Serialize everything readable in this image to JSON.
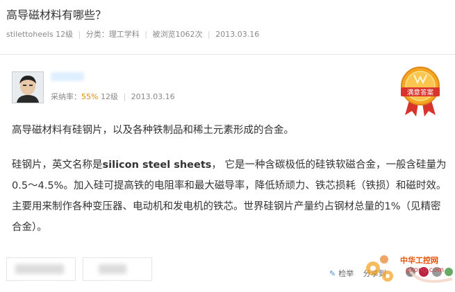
{
  "question": {
    "title": "高导磁材料有哪些？",
    "author": "stilettoheels",
    "author_level": "12级",
    "category": "分类：理工学科",
    "views": "被浏览1062次",
    "date": "2013.03.16"
  },
  "answer": {
    "adoption_label": "采纳率：",
    "adoption_rate": "55%",
    "level": "12级",
    "date": "2013.03.16",
    "badge_text": "满意答案",
    "paragraph1": "高导磁材料有硅钢片，以及各种铁制品和稀土元素形成的合金。",
    "p2_before": "硅钢片，英文名称是",
    "p2_english": "silicon steel sheets",
    "p2_after": "， 它是一种含碳极低的硅铁软磁合金，一般含硅量为0.5～4.5%。加入硅可提高铁的电阻率和最大磁导率，降低矫顽力、铁芯损耗（铁损）和磁时效。主要用来制作各种变压器、电动机和发电机的铁芯。世界硅钢片产量约占钢材总量的1%（见精密合金）。"
  },
  "footer": {
    "report_label": "检举",
    "share_label": "分享到"
  },
  "watermark": {
    "text": "中华工控网",
    "url": "gkong.com"
  },
  "colors": {
    "accent_orange": "#e58a00",
    "badge_red": "#d9342b",
    "badge_gold": "#f5a623"
  }
}
